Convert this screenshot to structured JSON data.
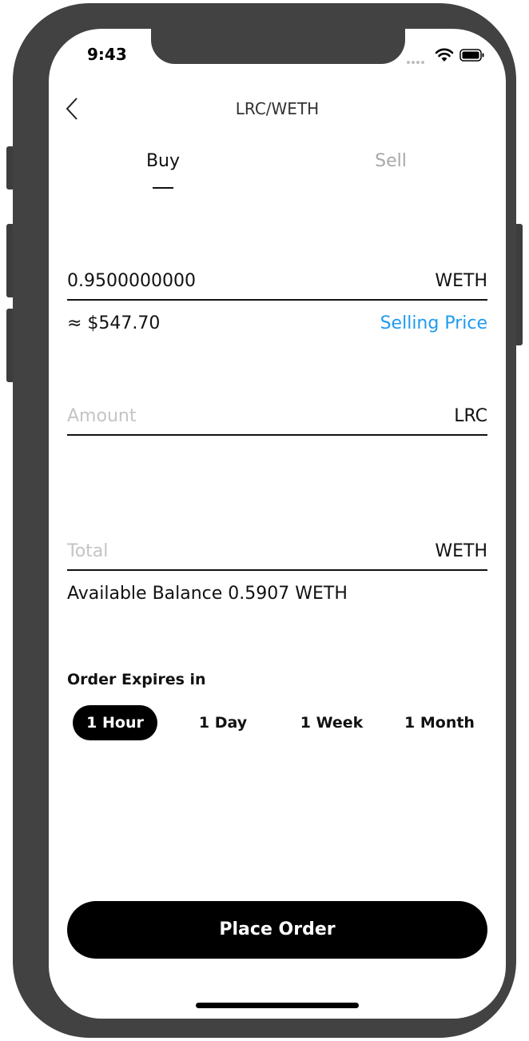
{
  "status_bar": {
    "time": "9:43"
  },
  "nav": {
    "title": "LRC/WETH"
  },
  "tabs": [
    {
      "label": "Buy",
      "active": true
    },
    {
      "label": "Sell",
      "active": false
    }
  ],
  "price_field": {
    "value": "0.9500000000",
    "unit": "WETH",
    "usd_estimate": "≈ $547.70",
    "selling_price_link": "Selling Price"
  },
  "amount_field": {
    "placeholder": "Amount",
    "value": "",
    "unit": "LRC"
  },
  "total_field": {
    "placeholder": "Total",
    "value": "",
    "unit": "WETH"
  },
  "balance": {
    "text": "Available Balance 0.5907 WETH"
  },
  "expiry": {
    "label": "Order Expires in",
    "options": [
      {
        "label": "1 Hour",
        "selected": true
      },
      {
        "label": "1 Day",
        "selected": false
      },
      {
        "label": "1 Week",
        "selected": false
      },
      {
        "label": "1 Month",
        "selected": false
      }
    ]
  },
  "actions": {
    "place_order": "Place Order"
  },
  "colors": {
    "accent_link": "#1e9bf0",
    "frame": "#424242",
    "button": "#000000"
  },
  "icons": [
    "back-chevron-icon",
    "wifi-icon",
    "battery-icon",
    "signal-dots-icon"
  ]
}
